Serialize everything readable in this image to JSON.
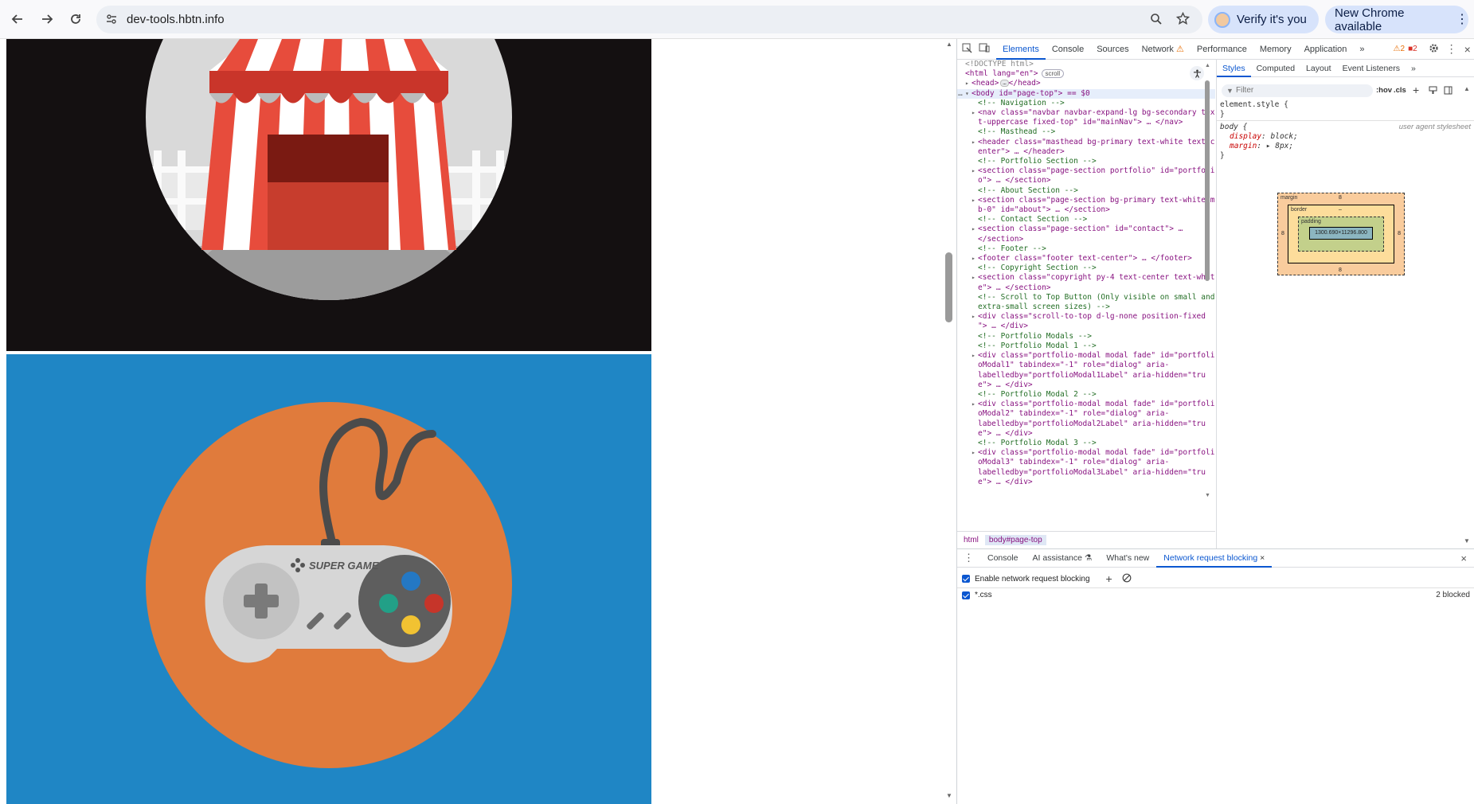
{
  "browser": {
    "url": "dev-tools.hbtn.info",
    "verify_label": "Verify it's you",
    "update_label": "New Chrome available"
  },
  "devtools": {
    "tabs": [
      "Elements",
      "Console",
      "Sources",
      "Network",
      "Performance",
      "Memory",
      "Application"
    ],
    "warning_count": "2",
    "error_count": "2",
    "dom": [
      {
        "t": "<!DOCTYPE html>",
        "k": "doctype"
      },
      {
        "t": "<html lang=\"en\">",
        "k": "html"
      },
      {
        "t": "<head>",
        "k": "head"
      },
      {
        "t": "<body id=\"page-top\"> == $0",
        "k": "body"
      },
      {
        "t": "<!-- Navigation -->",
        "k": "c"
      },
      {
        "t": "<nav class=\"navbar navbar-expand-lg bg-secondary tex",
        "k": "n"
      },
      {
        "t": "t-uppercase fixed-top\" id=\"mainNav\"> … </nav>",
        "k": "m"
      },
      {
        "t": "<!-- Masthead -->",
        "k": "c"
      },
      {
        "t": "<header class=\"masthead bg-primary text-white text-c",
        "k": "n"
      },
      {
        "t": "enter\"> … </header>",
        "k": "m"
      },
      {
        "t": "<!-- Portfolio Section -->",
        "k": "c"
      },
      {
        "t": "<section class=\"page-section portfolio\" id=\"portfoli",
        "k": "n"
      },
      {
        "t": "o\"> … </section>",
        "k": "m"
      },
      {
        "t": "<!-- About Section -->",
        "k": "c"
      },
      {
        "t": "<section class=\"page-section bg-primary text-white m",
        "k": "n"
      },
      {
        "t": "b-0\" id=\"about\"> … </section>",
        "k": "m"
      },
      {
        "t": "<!-- Contact Section -->",
        "k": "c"
      },
      {
        "t": "<section class=\"page-section\" id=\"contact\"> …",
        "k": "n"
      },
      {
        "t": "</section>",
        "k": "m"
      },
      {
        "t": "<!-- Footer -->",
        "k": "c"
      },
      {
        "t": "<footer class=\"footer text-center\"> … </footer>",
        "k": "n"
      },
      {
        "t": "<!-- Copyright Section -->",
        "k": "c"
      },
      {
        "t": "<section class=\"copyright py-4 text-center text-whit",
        "k": "n"
      },
      {
        "t": "e\"> … </section>",
        "k": "m"
      },
      {
        "t": "<!-- Scroll to Top Button (Only visible on small and",
        "k": "c"
      },
      {
        "t": "extra-small screen sizes) -->",
        "k": "c"
      },
      {
        "t": "<div class=\"scroll-to-top d-lg-none position-fixed",
        "k": "n"
      },
      {
        "t": "\"> … </div>",
        "k": "m"
      },
      {
        "t": "<!-- Portfolio Modals -->",
        "k": "c"
      },
      {
        "t": "<!-- Portfolio Modal 1 -->",
        "k": "c"
      },
      {
        "t": "<div class=\"portfolio-modal modal fade\" id=\"portfoli",
        "k": "n"
      },
      {
        "t": "oModal1\" tabindex=\"-1\" role=\"dialog\" aria-",
        "k": "m"
      },
      {
        "t": "labelledby=\"portfolioModal1Label\" aria-hidden=\"tru",
        "k": "m"
      },
      {
        "t": "e\"> … </div>",
        "k": "m"
      },
      {
        "t": "<!-- Portfolio Modal 2 -->",
        "k": "c"
      },
      {
        "t": "<div class=\"portfolio-modal modal fade\" id=\"portfoli",
        "k": "n"
      },
      {
        "t": "oModal2\" tabindex=\"-1\" role=\"dialog\" aria-",
        "k": "m"
      },
      {
        "t": "labelledby=\"portfolioModal2Label\" aria-hidden=\"tru",
        "k": "m"
      },
      {
        "t": "e\"> … </div>",
        "k": "m"
      },
      {
        "t": "<!-- Portfolio Modal 3 -->",
        "k": "c"
      },
      {
        "t": "<div class=\"portfolio-modal modal fade\" id=\"portfoli",
        "k": "n"
      },
      {
        "t": "oModal3\" tabindex=\"-1\" role=\"dialog\" aria-",
        "k": "m"
      },
      {
        "t": "labelledby=\"portfolioModal3Label\" aria-hidden=\"tru",
        "k": "m"
      },
      {
        "t": "e\"> … </div>",
        "k": "m"
      }
    ],
    "scroll_badge": "scroll",
    "breadcrumbs": [
      "html",
      "body#page-top"
    ],
    "styles_tabs": [
      "Styles",
      "Computed",
      "Layout",
      "Event Listeners"
    ],
    "filter_placeholder": "Filter",
    "hov": ":hov",
    "cls": ".cls",
    "element_style": "element.style {",
    "close_brace": "}",
    "body_selector": "body {",
    "user_agent": "user agent stylesheet",
    "rule1_prop": "display",
    "rule1_val": "block;",
    "rule2_prop": "margin",
    "rule2_val": "8px;",
    "box_model": {
      "margin": "margin",
      "border": "border",
      "padding": "padding",
      "margin_val": "8",
      "dash": "–",
      "content": "1300.690×11296.800"
    },
    "drawer": {
      "tabs": [
        "Console",
        "AI assistance",
        "What's new",
        "Network request blocking"
      ],
      "enable_label": "Enable network request blocking",
      "pattern": "*.css",
      "blocked": "2 blocked"
    }
  }
}
